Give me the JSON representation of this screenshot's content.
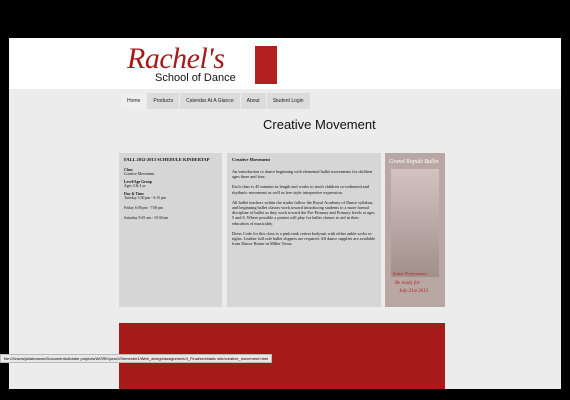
{
  "logo": {
    "script": "Rachel's",
    "sub": "School of Dance"
  },
  "nav": [
    {
      "label": "Home"
    },
    {
      "label": "Products"
    },
    {
      "label": "Calendar At A Glance"
    },
    {
      "label": "About"
    },
    {
      "label": "Student Login"
    }
  ],
  "page": {
    "title": "Creative Movement"
  },
  "schedule": {
    "heading": "FALL 2012-2013 SCHEDULE KINDERTAP",
    "class_label": "Class",
    "class_value": "Creative Movement",
    "level_label": "Level/Age Group",
    "level_value": "Ages 3 & 4 yr.",
    "day_label": "Day & Time",
    "times": [
      "Tuesday 5:30 pm - 6:15 pm",
      "Friday 6:00 pm - 7:00 pm",
      "Saturday 9:45 am - 10:30 am"
    ]
  },
  "description": {
    "heading": "Creative Movement",
    "paragraphs": [
      "An introduction to dance beginning with elemental ballet movements for children ages three and four.",
      "Each class is 45 minutes in length and works to teach children co-ordinated and rhythmic movement as well as free style interpretive expression.",
      "All ballet teachers within the studio follow the Royal Academy of Dance syllabus, and beginning ballet classes work toward introducing students to a more formal discipline of ballet as they work toward the Pre-Primary and Primary levels at ages 5 and 6. Where possible a pianist will play for ballet classes to aid in their education of musicality.",
      "Dress Code for this class is a pink tank cotton bodysuit with either ankle socks or tights. Leather full sole ballet slippers are required. All dance supplies are available from Dance House in Miller Town."
    ]
  },
  "poster": {
    "title": "Grand Rapids Ballet",
    "line1": "Senior Performance",
    "line2": "Be ready for",
    "line3": "July 21st 2013"
  },
  "status_bar": {
    "url": "file:///Users/juliabrowne/Documents/Adobe projects/WORK/year1/Semester1/Web_design/assignment/4_Final/red/static site/creative_movement.html"
  }
}
